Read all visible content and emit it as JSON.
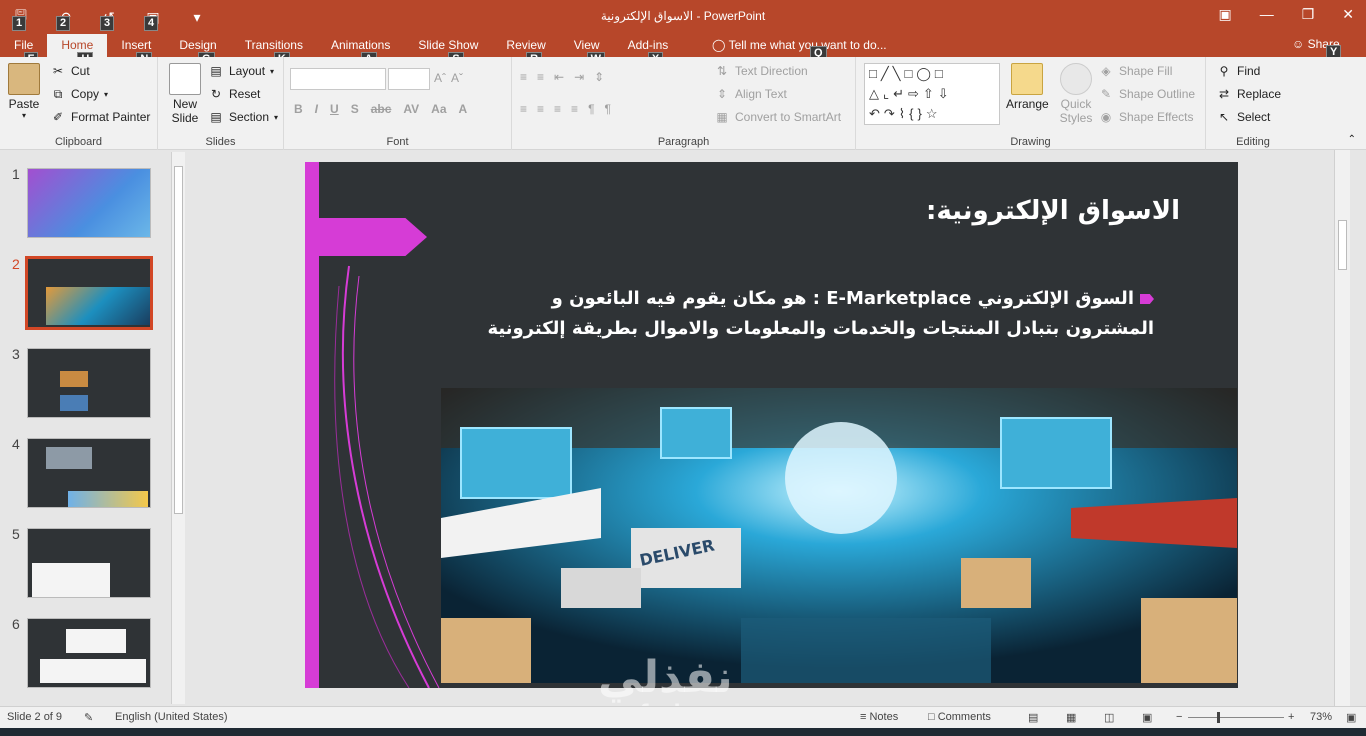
{
  "window": {
    "title": "الاسواق الإلكترونية - PowerPoint",
    "tell_me": "Tell me what you want to do...",
    "share": "Share"
  },
  "qat": {
    "keytips": [
      "1",
      "2",
      "3",
      "4"
    ]
  },
  "tabs": [
    {
      "label": "File",
      "keytip": "F"
    },
    {
      "label": "Home",
      "keytip": "H",
      "active": true
    },
    {
      "label": "Insert",
      "keytip": "N"
    },
    {
      "label": "Design",
      "keytip": "G"
    },
    {
      "label": "Transitions",
      "keytip": "K"
    },
    {
      "label": "Animations",
      "keytip": "A"
    },
    {
      "label": "Slide Show",
      "keytip": "S"
    },
    {
      "label": "Review",
      "keytip": "R"
    },
    {
      "label": "View",
      "keytip": "W"
    },
    {
      "label": "Add-ins",
      "keytip": "X"
    }
  ],
  "extra_keytips": {
    "tell_me": "Q",
    "share": "Y"
  },
  "ribbon": {
    "clipboard": {
      "label": "Clipboard",
      "paste": "Paste",
      "cut": "Cut",
      "copy": "Copy",
      "format_painter": "Format Painter"
    },
    "slides": {
      "label": "Slides",
      "new_slide": "New Slide",
      "layout": "Layout",
      "reset": "Reset",
      "section": "Section"
    },
    "font": {
      "label": "Font"
    },
    "paragraph": {
      "label": "Paragraph",
      "text_direction": "Text Direction",
      "align_text": "Align Text",
      "smartart": "Convert to SmartArt"
    },
    "drawing": {
      "label": "Drawing",
      "arrange": "Arrange",
      "quick_styles": "Quick Styles",
      "shape_fill": "Shape Fill",
      "shape_outline": "Shape Outline",
      "shape_effects": "Shape Effects"
    },
    "editing": {
      "label": "Editing",
      "find": "Find",
      "replace": "Replace",
      "select": "Select"
    }
  },
  "thumbnails": {
    "numbers": [
      "1",
      "2",
      "3",
      "4",
      "5",
      "6"
    ],
    "selected": "2"
  },
  "slide": {
    "title": "الاسواق الإلكترونية:",
    "body_line1": "السوق الإلكتروني E-Marketplace : هو مكان يقوم فيه البائعون و",
    "body_line2": "المشترون بتبادل المنتجات والخدمات والمعلومات والاموال بطريقة إلكترونية",
    "image_text": "DELIVER"
  },
  "watermark": {
    "arabic": "نفذلي",
    "latin": "nafezly.com"
  },
  "status": {
    "slide_info": "Slide 2 of 9",
    "language": "English (United States)",
    "notes": "Notes",
    "comments": "Comments",
    "zoom": "73%"
  },
  "colors": {
    "accent": "#b7472a",
    "slide_bg": "#2f3336",
    "slide_accent": "#d63cd6"
  }
}
